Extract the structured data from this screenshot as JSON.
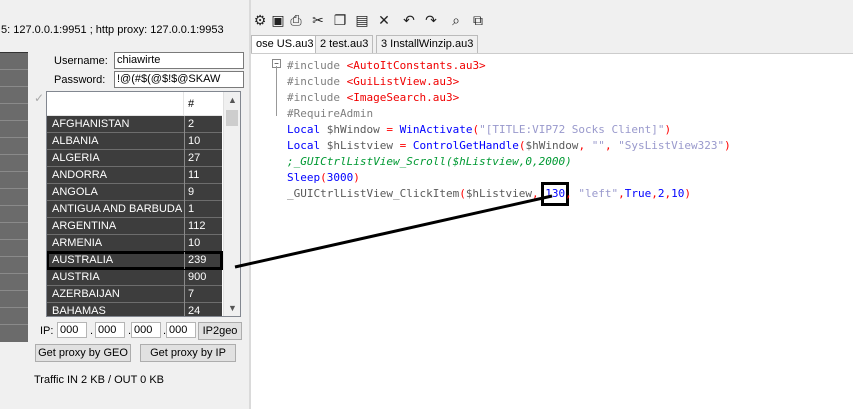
{
  "left_window": {
    "status_line": "5: 127.0.0.1:9951 ; http proxy:  127.0.0.1:9953",
    "username_label": "Username:",
    "username_value": "chiawirte",
    "password_label": "Password:",
    "password_value": "!@(#$(@$!$@SKAW",
    "list_header_count": "#",
    "countries": [
      {
        "name": "AFGHANISTAN",
        "count": "2"
      },
      {
        "name": "ALBANIA",
        "count": "10"
      },
      {
        "name": "ALGERIA",
        "count": "27"
      },
      {
        "name": "ANDORRA",
        "count": "11"
      },
      {
        "name": "ANGOLA",
        "count": "9"
      },
      {
        "name": "ANTIGUA AND BARBUDA",
        "count": "1"
      },
      {
        "name": "ARGENTINA",
        "count": "112"
      },
      {
        "name": "ARMENIA",
        "count": "10"
      },
      {
        "name": "AUSTRALIA",
        "count": "239"
      },
      {
        "name": "AUSTRIA",
        "count": "900"
      },
      {
        "name": "AZERBAIJAN",
        "count": "7"
      },
      {
        "name": "BAHAMAS",
        "count": "24"
      }
    ],
    "ip_label": "IP:",
    "ip_octets": [
      "000",
      "000",
      "000",
      "000"
    ],
    "ip_dot": ".",
    "ip2geo_button": "IP2geo",
    "geo_button": "Get proxy by GEO",
    "ip_button": "Get proxy by IP",
    "traffic": "Traffic IN 2 KB / OUT 0 KB"
  },
  "right_window": {
    "tabs": [
      "ose US.au3",
      "2 test.au3",
      "3 InstallWinzip.au3"
    ],
    "fold_symbol": "−",
    "code": {
      "l1_dir": "#include ",
      "l1_file": "<AutoItConstants.au3>",
      "l2_dir": "#include ",
      "l2_file": "<GuiListView.au3>",
      "l3_dir": "#include ",
      "l3_file": "<ImageSearch.au3>",
      "l4": "#RequireAdmin",
      "l5_kw": "Local ",
      "l5_var": "$hWindow",
      "l5_eq": " = ",
      "l5_fn": "WinActivate",
      "l5_open": "(",
      "l5_str": "\"[TITLE:VIP72 Socks Client]\"",
      "l5_close": ")",
      "l6_kw": "Local ",
      "l6_var": "$hListview",
      "l6_eq": " = ",
      "l6_fn": "ControlGetHandle",
      "l6_open": "(",
      "l6_arg": "$hWindow",
      "l6_c1": ", ",
      "l6_str1": "\"\"",
      "l6_c2": ", ",
      "l6_str2": "\"SysListView323\"",
      "l6_close": ")",
      "l7": ";_GUICtrlListView_Scroll($hListview,0,2000)",
      "l8_fn": "Sleep",
      "l8_open": "(",
      "l8_num": "3000",
      "l8_close": ")",
      "l9_fn": "_GUICtrlListView_ClickItem",
      "l9_open": "(",
      "l9_var": "$hListview",
      "l9_c1": ", ",
      "l9_num": "130",
      "l9_c2": ", ",
      "l9_str": "\"left\"",
      "l9_c3": ",",
      "l9_true": "True",
      "l9_c4": ",",
      "l9_n2": "2",
      "l9_c5": ",",
      "l9_n3": "10",
      "l9_close": ")"
    }
  }
}
